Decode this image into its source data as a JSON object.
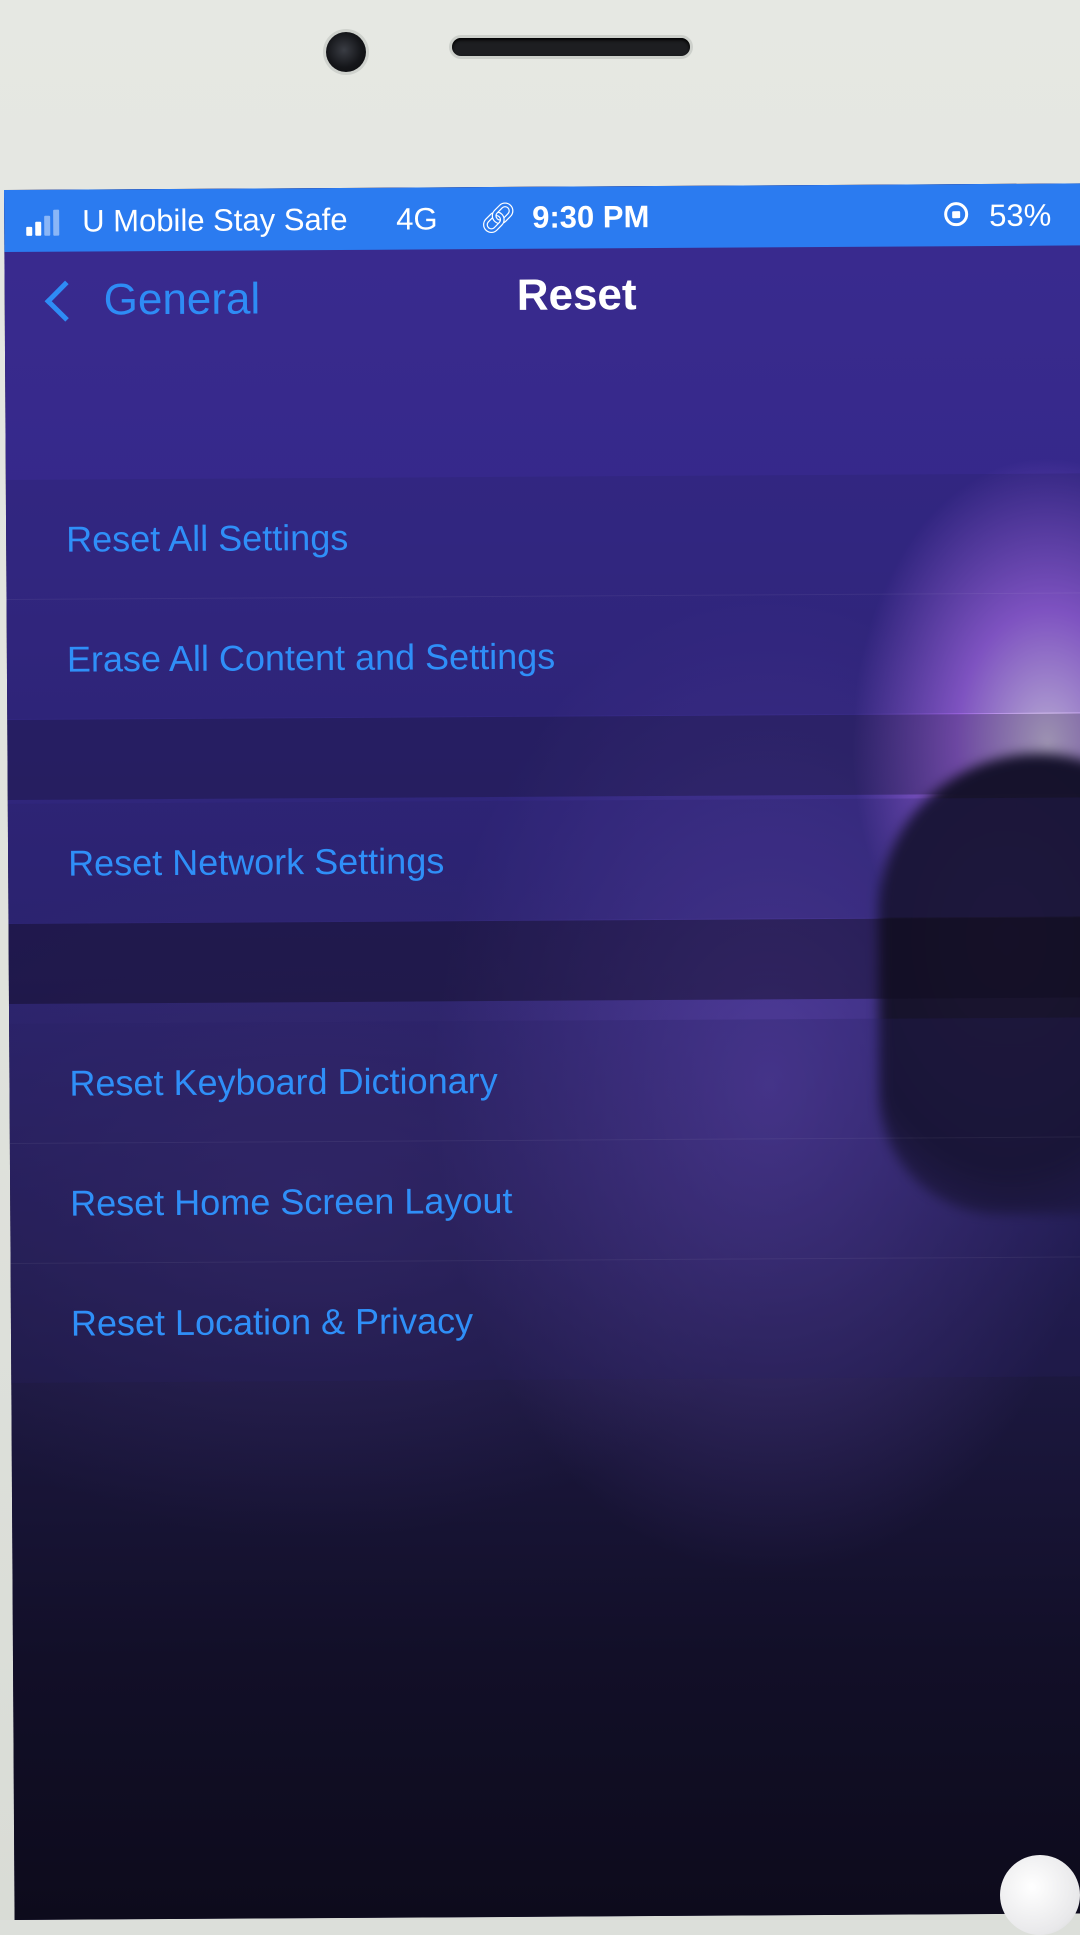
{
  "status_bar": {
    "carrier": "U Mobile Stay Safe",
    "network": "4G",
    "time": "9:30 PM",
    "battery": "53%",
    "icons": [
      "signal-icon",
      "link-icon",
      "rotation-lock-icon"
    ]
  },
  "nav": {
    "back_label": "General",
    "title": "Reset"
  },
  "groups": [
    {
      "items": [
        "Reset All Settings",
        "Erase All Content and Settings"
      ]
    },
    {
      "items": [
        "Reset Network Settings"
      ]
    },
    {
      "items": [
        "Reset Keyboard Dictionary",
        "Reset Home Screen Layout",
        "Reset Location & Privacy"
      ]
    }
  ],
  "colors": {
    "accent": "#2f8ff8",
    "status_bar": "#2b7bf0",
    "background": "#2c2472"
  }
}
